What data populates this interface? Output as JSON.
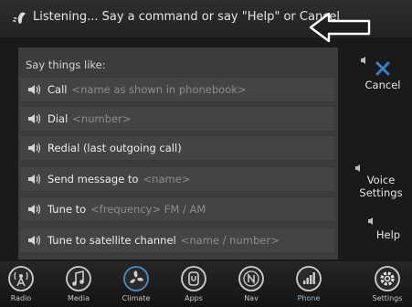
{
  "banner": {
    "text": "Listening... Say a command or say \"Help\" or Cancel"
  },
  "panel": {
    "heading": "Say things like:",
    "commands": [
      {
        "main": "Call",
        "hint": "<name as shown in phonebook>"
      },
      {
        "main": "Dial",
        "hint": "<number>"
      },
      {
        "main": "Redial (last outgoing call)",
        "hint": ""
      },
      {
        "main": "Send message to",
        "hint": "<name>"
      },
      {
        "main": "Tune to",
        "hint": "<frequency> FM / AM"
      },
      {
        "main": "Tune to satellite channel",
        "hint": "<name / number>"
      }
    ]
  },
  "side": {
    "cancel": "Cancel",
    "voice_settings_1": "Voice",
    "voice_settings_2": "Settings",
    "help": "Help"
  },
  "nav": {
    "items": [
      {
        "label": "Radio",
        "icon": "radio-tower-icon"
      },
      {
        "label": "Media",
        "icon": "music-note-icon"
      },
      {
        "label": "Climate",
        "icon": "fan-icon"
      },
      {
        "label": "Apps",
        "icon": "apps-icon"
      },
      {
        "label": "Nav",
        "icon": "compass-icon"
      },
      {
        "label": "Phone",
        "icon": "signal-bars-icon"
      },
      {
        "label": "Settings",
        "icon": "gear-icon"
      }
    ],
    "active": "Phone"
  },
  "colors": {
    "accent": "#3a7fc8",
    "panel": "#3c3c3c",
    "row": "#444444"
  }
}
